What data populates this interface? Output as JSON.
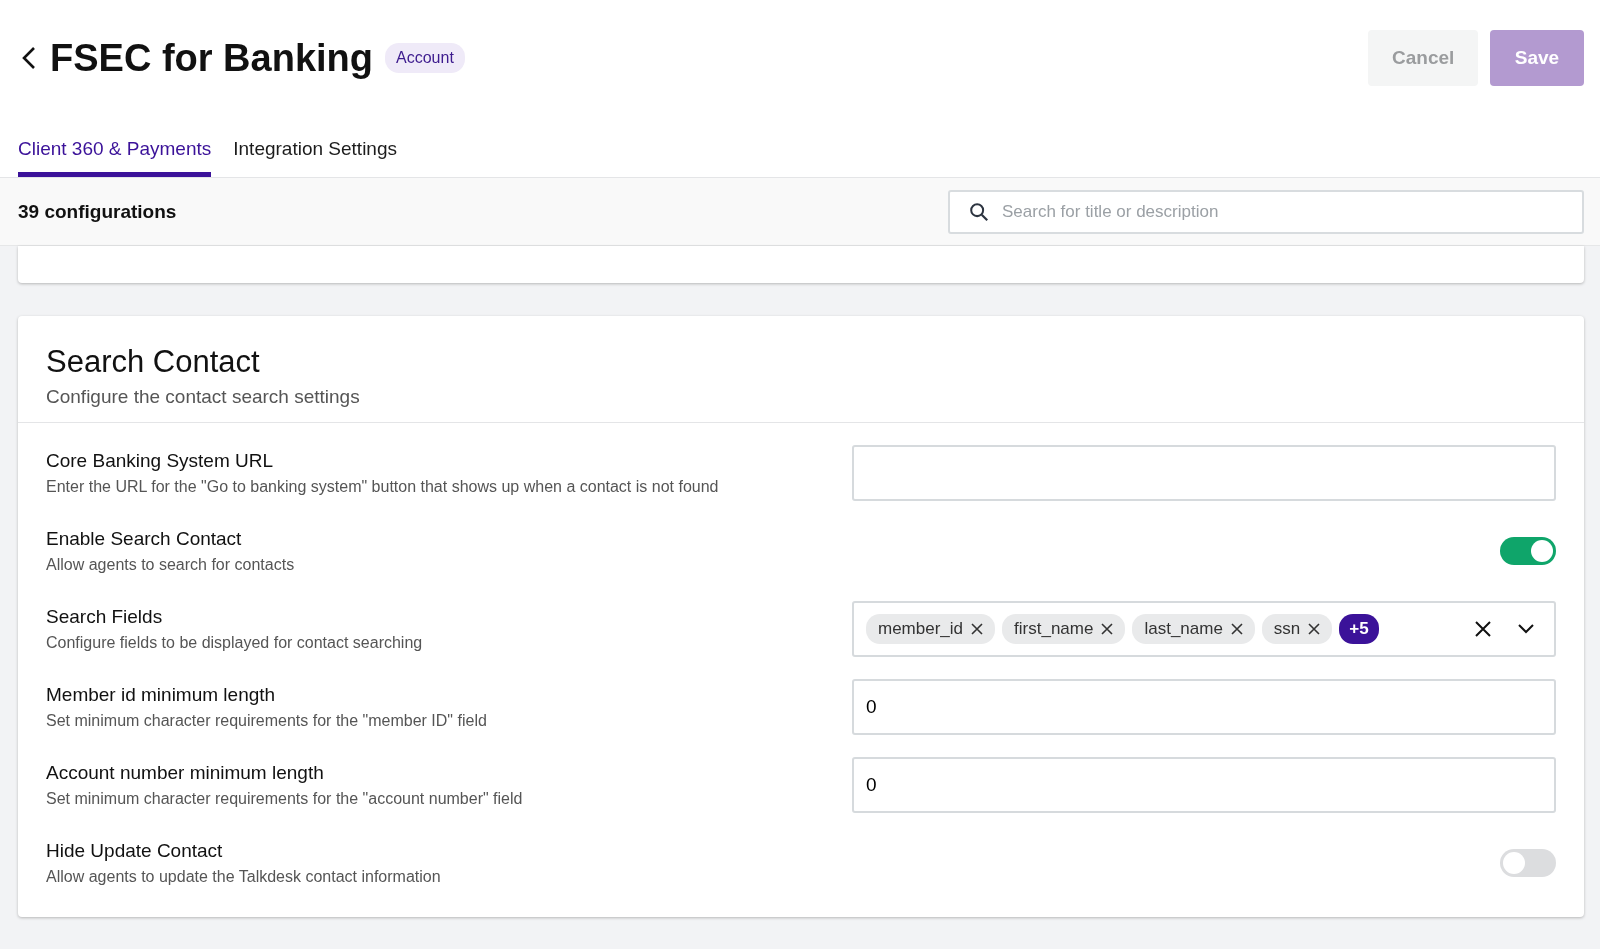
{
  "header": {
    "title": "FSEC for Banking",
    "badge": "Account",
    "buttons": [
      {
        "label": "Cancel",
        "kind": "secondary"
      },
      {
        "label": "Save",
        "kind": "primary"
      }
    ]
  },
  "tabs": [
    {
      "label": "Client 360 & Payments",
      "selected": true
    },
    {
      "label": "Integration Settings",
      "selected": false
    }
  ],
  "toolbar": {
    "count": "39 configurations",
    "search": {
      "placeholder": "Search for title or description"
    }
  },
  "section": {
    "title": "Search Contact",
    "subtitle": "Configure the contact search settings",
    "settings": [
      {
        "kind": "text",
        "label": "Core Banking System URL",
        "description": "Enter the URL for the \"Go to banking system\" button that shows up when a contact is not found"
      },
      {
        "kind": "toggle",
        "label": "Enable Search Contact",
        "description": "Allow agents to search for contacts",
        "on": true
      },
      {
        "kind": "tags",
        "label": "Search Fields",
        "description": "Configure fields to be displayed for contact searching",
        "tags": [
          "member_id",
          "first_name",
          "last_name",
          "ssn"
        ],
        "more": "+5"
      },
      {
        "kind": "text",
        "label": "Member id minimum length",
        "description": "Set minimum character requirements for the \"member ID\" field",
        "value": "0"
      },
      {
        "kind": "text",
        "label": "Account number minimum length",
        "description": "Set minimum character requirements for the \"account number\" field",
        "value": "0"
      },
      {
        "kind": "toggle",
        "label": "Hide Update Contact",
        "description": "Allow agents to update the Talkdesk contact information",
        "on": false
      }
    ]
  }
}
